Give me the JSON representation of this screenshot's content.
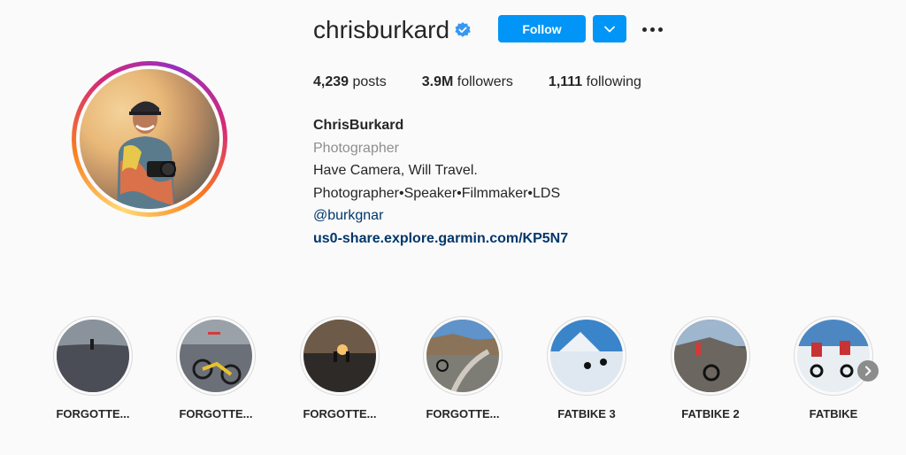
{
  "profile": {
    "username": "chrisburkard",
    "follow_label": "Follow",
    "icons": {
      "verified": "verified-badge-icon",
      "dropdown": "chevron-down-icon",
      "more": "more-options-icon"
    },
    "colors": {
      "follow_button": "#0095f6",
      "link": "#00376b",
      "category": "#8e8e8e"
    }
  },
  "stats": {
    "posts_count": "4,239",
    "posts_label": "posts",
    "followers_count": "3.9M",
    "followers_label": "followers",
    "following_count": "1,111",
    "following_label": "following"
  },
  "bio": {
    "name": "ChrisBurkard",
    "category": "Photographer",
    "line1": "Have Camera, Will Travel.",
    "line2": "Photographer•Speaker•Filmmaker•LDS",
    "mention": "@burkgnar",
    "link": "us0-share.explore.garmin.com/KP5N7"
  },
  "highlights": [
    {
      "label": "FORGOTTE..."
    },
    {
      "label": "FORGOTTE..."
    },
    {
      "label": "FORGOTTE..."
    },
    {
      "label": "FORGOTTE..."
    },
    {
      "label": "FATBIKE 3"
    },
    {
      "label": "FATBIKE 2"
    },
    {
      "label": "FATBIKE"
    }
  ],
  "highlights_next_icon": "chevron-right-icon"
}
